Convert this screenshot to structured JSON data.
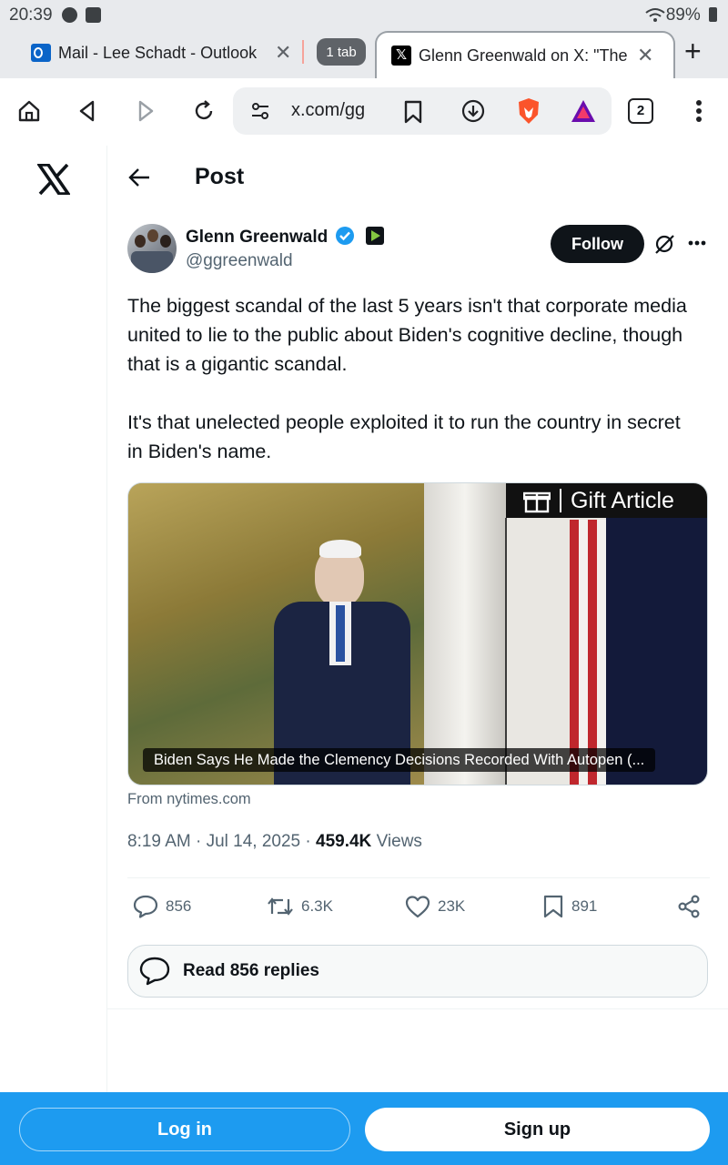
{
  "status_bar": {
    "time": "20:39",
    "battery": "89%"
  },
  "tabs": [
    {
      "title": "Mail - Lee Schadt - Outlook",
      "icon": "outlook-icon"
    },
    {
      "title": "Glenn Greenwald on X: \"The b",
      "icon": "x-icon",
      "active": true
    }
  ],
  "tab_group_label": "1 tab",
  "toolbar": {
    "url": "x.com/gg",
    "tab_count": "2"
  },
  "page": {
    "title": "Post",
    "author": {
      "name": "Glenn Greenwald",
      "handle": "@ggreenwald",
      "verified": true
    },
    "follow_label": "Follow",
    "text": [
      "The biggest scandal of the last 5 years isn't that corporate media united to lie to the public about Biden's  cognitive decline, though that is a gigantic scandal.",
      "It's that unelected people exploited it to run the country in secret in Biden's name."
    ],
    "card": {
      "overlay_label": "Gift Article",
      "caption": "Biden Says He Made the Clemency Decisions Recorded With Autopen (...",
      "source": "From nytimes.com"
    },
    "meta": {
      "time": "8:19 AM · Jul 14, 2025 · ",
      "views_count": "459.4K",
      "views_label": " Views"
    },
    "actions": {
      "replies": "856",
      "reposts": "6.3K",
      "likes": "23K",
      "bookmarks": "891"
    },
    "read_replies_label": "Read 856 replies"
  },
  "auth": {
    "login_label": "Log in",
    "signup_label": "Sign up"
  },
  "colors": {
    "accent": "#1d9bf0",
    "verified": "#1d9bf0",
    "text": "#0f1419",
    "muted": "#536471"
  }
}
